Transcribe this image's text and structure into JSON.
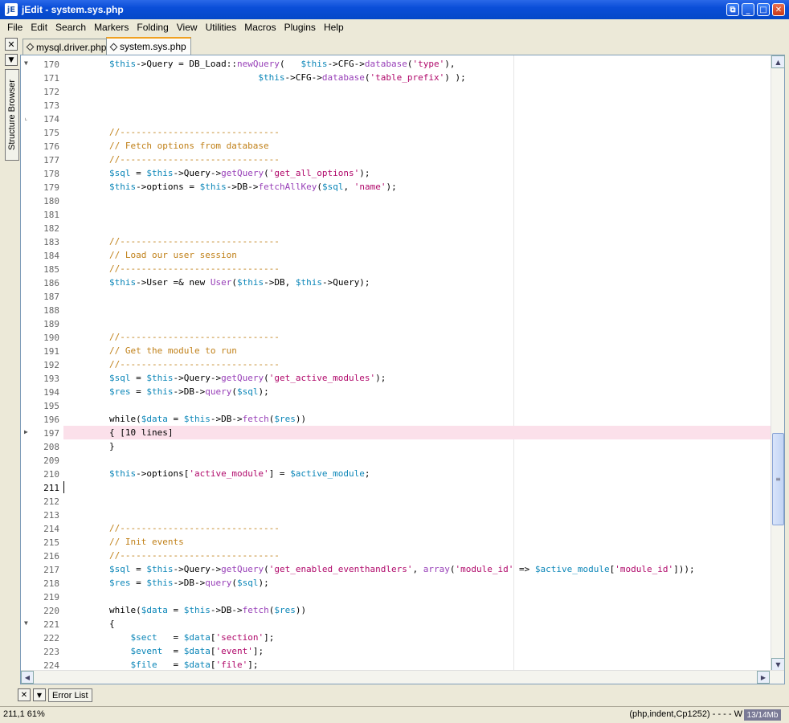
{
  "window": {
    "title": "jEdit - system.sys.php",
    "app_icon": "jE"
  },
  "menu": [
    "File",
    "Edit",
    "Search",
    "Markers",
    "Folding",
    "View",
    "Utilities",
    "Macros",
    "Plugins",
    "Help"
  ],
  "tabs": [
    {
      "label": "mysql.driver.php",
      "active": false
    },
    {
      "label": "system.sys.php",
      "active": true
    }
  ],
  "left_dock": {
    "label": "Structure Browser"
  },
  "bottom_dock": {
    "label": "Error List"
  },
  "status": {
    "position": "211,1 61%",
    "mode": "(php,indent,Cp1252) - - - - W",
    "memory": "13/14Mb"
  },
  "editor": {
    "caret_line": "211",
    "highlighted_line": "197",
    "lines": [
      {
        "n": "170",
        "fold": "down",
        "code": "        <v>$this</v>->Query = DB_Load::<f>newQuery</f>(   <v>$this</v>->CFG-><f>database</f>(<s>'type'</s>),"
      },
      {
        "n": "171",
        "code": "                                    <v>$this</v>->CFG-><f>database</f>(<s>'table_prefix'</s>) );"
      },
      {
        "n": "172",
        "code": ""
      },
      {
        "n": "173",
        "code": ""
      },
      {
        "n": "174",
        "fold": "end",
        "code": ""
      },
      {
        "n": "175",
        "code": "        <c>//------------------------------</c>"
      },
      {
        "n": "176",
        "code": "        <c>// Fetch options from database</c>"
      },
      {
        "n": "177",
        "code": "        <c>//------------------------------</c>"
      },
      {
        "n": "178",
        "code": "        <v>$sql</v> = <v>$this</v>->Query-><f>getQuery</f>(<s>'get_all_options'</s>);"
      },
      {
        "n": "179",
        "code": "        <v>$this</v>->options = <v>$this</v>->DB-><f>fetchAllKey</f>(<v>$sql</v>, <s>'name'</s>);"
      },
      {
        "n": "180",
        "code": ""
      },
      {
        "n": "181",
        "code": ""
      },
      {
        "n": "182",
        "code": ""
      },
      {
        "n": "183",
        "code": "        <c>//------------------------------</c>"
      },
      {
        "n": "184",
        "code": "        <c>// Load our user session</c>"
      },
      {
        "n": "185",
        "code": "        <c>//------------------------------</c>"
      },
      {
        "n": "186",
        "code": "        <v>$this</v>->User =& new <f>User</f>(<v>$this</v>->DB, <v>$this</v>->Query);"
      },
      {
        "n": "187",
        "code": ""
      },
      {
        "n": "188",
        "code": ""
      },
      {
        "n": "189",
        "code": ""
      },
      {
        "n": "190",
        "code": "        <c>//------------------------------</c>"
      },
      {
        "n": "191",
        "code": "        <c>// Get the module to run</c>"
      },
      {
        "n": "192",
        "code": "        <c>//------------------------------</c>"
      },
      {
        "n": "193",
        "code": "        <v>$sql</v> = <v>$this</v>->Query-><f>getQuery</f>(<s>'get_active_modules'</s>);"
      },
      {
        "n": "194",
        "code": "        <v>$res</v> = <v>$this</v>->DB-><f>query</f>(<v>$sql</v>);"
      },
      {
        "n": "195",
        "code": ""
      },
      {
        "n": "196",
        "code": "        while(<v>$data</v> = <v>$this</v>->DB-><f>fetch</f>(<v>$res</v>))"
      },
      {
        "n": "197",
        "fold": "right",
        "code": "        { [10 lines]"
      },
      {
        "n": "208",
        "code": "        }"
      },
      {
        "n": "209",
        "code": ""
      },
      {
        "n": "210",
        "code": "        <v>$this</v>->options[<s>'active_module'</s>] = <v>$active_module</v>;"
      },
      {
        "n": "211",
        "code": ""
      },
      {
        "n": "212",
        "code": ""
      },
      {
        "n": "213",
        "code": ""
      },
      {
        "n": "214",
        "code": "        <c>//------------------------------</c>"
      },
      {
        "n": "215",
        "code": "        <c>// Init events</c>"
      },
      {
        "n": "216",
        "code": "        <c>//------------------------------</c>"
      },
      {
        "n": "217",
        "code": "        <v>$sql</v> = <v>$this</v>->Query-><f>getQuery</f>(<s>'get_enabled_eventhandlers'</s>, <f>array</f>(<s>'module_id'</s> => <v>$active_module</v>[<s>'module_id'</s>]));"
      },
      {
        "n": "218",
        "code": "        <v>$res</v> = <v>$this</v>->DB-><f>query</f>(<v>$sql</v>);"
      },
      {
        "n": "219",
        "code": ""
      },
      {
        "n": "220",
        "code": "        while(<v>$data</v> = <v>$this</v>->DB-><f>fetch</f>(<v>$res</v>))"
      },
      {
        "n": "221",
        "fold": "down",
        "code": "        {"
      },
      {
        "n": "222",
        "code": "            <v>$sect</v>   = <v>$data</v>[<s>'section'</s>];"
      },
      {
        "n": "223",
        "code": "            <v>$event</v>  = <v>$data</v>[<s>'event'</s>];"
      },
      {
        "n": "224",
        "code": "            <v>$file</v>   = <v>$data</v>[<s>'file'</s>];"
      }
    ]
  }
}
